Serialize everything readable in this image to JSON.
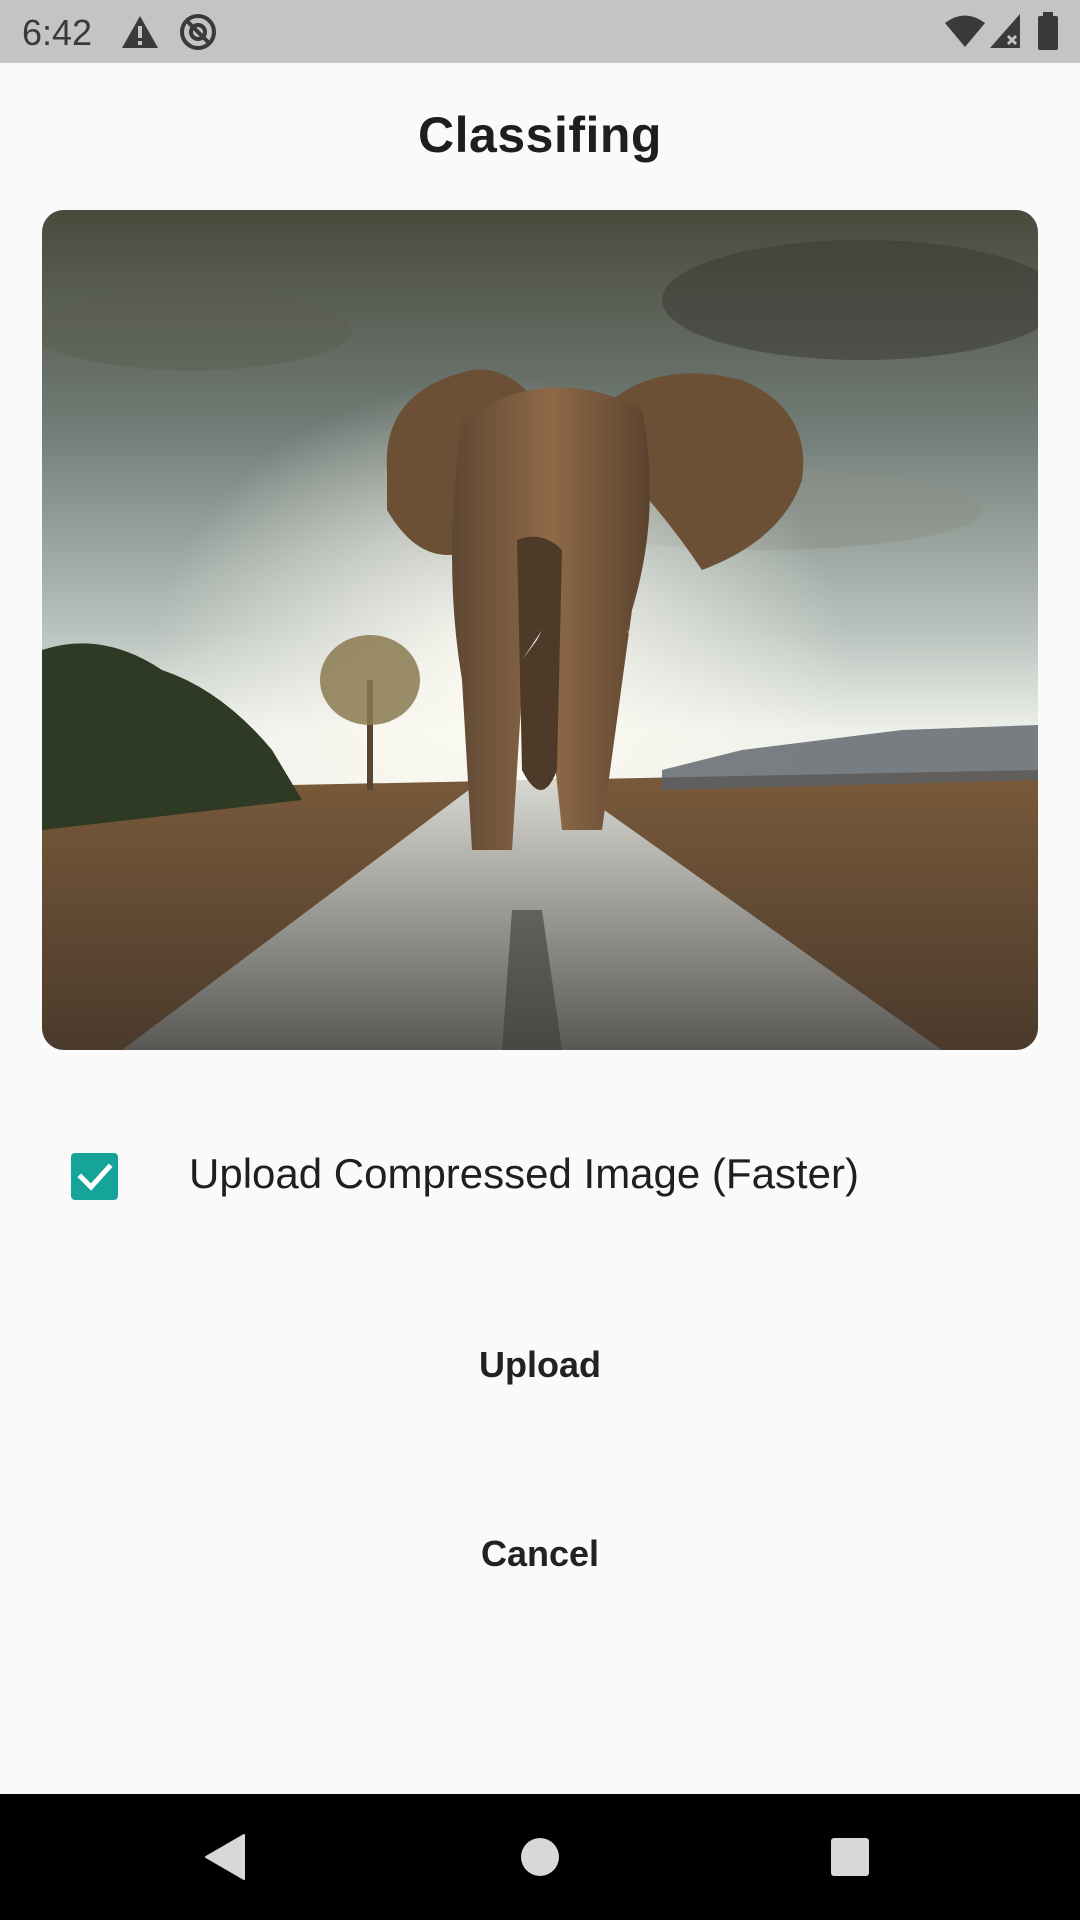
{
  "status_bar": {
    "time": "6:42",
    "icons": [
      "warning-icon",
      "no-sync-icon",
      "wifi-icon",
      "cellular-no-data-icon",
      "battery-icon"
    ]
  },
  "header": {
    "title": "Classifing"
  },
  "preview": {
    "subject": "elephant walking on road photo"
  },
  "options": {
    "compress_checked": true,
    "compress_label": "Upload Compressed Image (Faster)",
    "accent_color": "#16a39a"
  },
  "actions": {
    "upload_label": "Upload",
    "cancel_label": "Cancel"
  },
  "nav_bar": {
    "icons": [
      "back-icon",
      "home-icon",
      "recents-icon"
    ]
  }
}
